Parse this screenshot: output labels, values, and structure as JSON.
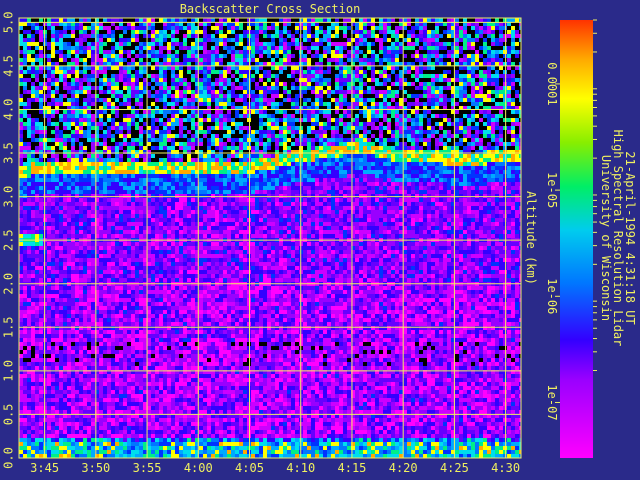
{
  "chart_data": {
    "type": "heatmap",
    "title": "Backscatter Cross Section",
    "ylabel": "Altitude (km)",
    "xlabel": "",
    "x_ticks": [
      "3:45",
      "3:50",
      "3:55",
      "4:00",
      "4:05",
      "4:10",
      "4:15",
      "4:20",
      "4:25",
      "4:30"
    ],
    "x_tick_minutes": [
      225,
      230,
      235,
      240,
      245,
      250,
      255,
      260,
      265,
      270
    ],
    "xlim_minutes": [
      222.5,
      271.5
    ],
    "y_ticks": [
      "0.0",
      "0.5",
      "1.0",
      "1.5",
      "2.0",
      "2.5",
      "3.0",
      "3.5",
      "4.0",
      "4.5",
      "5.0"
    ],
    "ylim": [
      0.0,
      5.05
    ],
    "grid": true,
    "colorbar": {
      "scale": "log",
      "range": [
        3e-08,
        0.0004
      ],
      "tick_labels": [
        "0.0001",
        "1e-05",
        "1e-06",
        "1e-07"
      ],
      "tick_values": [
        0.0001,
        1e-05,
        1e-06,
        1e-07
      ]
    },
    "annotations": [
      "University of Wisconsin",
      "High Spectral Resolution Lidar",
      "21-April-1994  4:31:18 UT"
    ],
    "cloud_layer_top_km": [
      [
        222.5,
        3.25
      ],
      [
        230,
        3.3
      ],
      [
        240,
        3.3
      ],
      [
        244,
        3.28
      ],
      [
        247,
        3.33
      ],
      [
        250,
        3.42
      ],
      [
        253,
        3.46
      ],
      [
        256,
        3.52
      ],
      [
        259,
        3.44
      ],
      [
        263,
        3.4
      ],
      [
        266,
        3.38
      ],
      [
        269,
        3.4
      ]
    ],
    "thin_layer": {
      "altitude_km": 2.5,
      "minutes": [
        222.5,
        225
      ]
    },
    "colors": {
      "background": "#2a2a8a",
      "grid": "#f0f060",
      "text": "#f0f060"
    }
  }
}
